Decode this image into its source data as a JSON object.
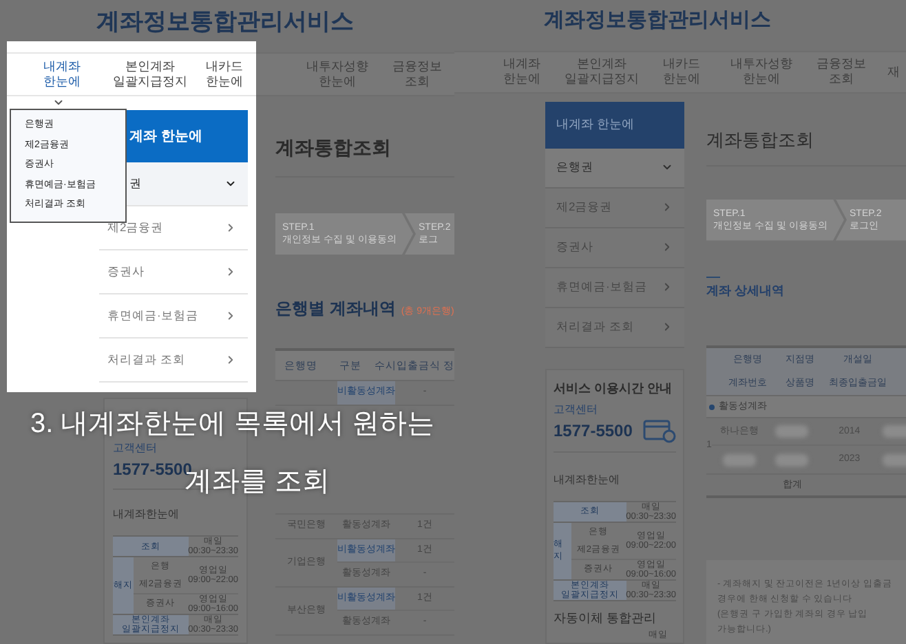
{
  "caption": {
    "lines": [
      "3. 내계좌한눈에 목록에서 원하는",
      "계좌를 조회"
    ]
  },
  "left_screen": {
    "site_title": "계좌정보통합관리서비스",
    "nav_tabs": [
      {
        "lines": [
          "내계좌",
          "한눈에"
        ],
        "selected": true
      },
      {
        "lines": [
          "본인계좌",
          "일괄지급정지"
        ],
        "selected": false
      },
      {
        "lines": [
          "내카드",
          "한눈에"
        ],
        "selected": false
      },
      {
        "lines": [
          "내투자성향",
          "한눈에"
        ],
        "selected": false
      },
      {
        "lines": [
          "금융정보",
          "조회"
        ],
        "selected": false
      }
    ],
    "dropdown": {
      "items": [
        "은행권",
        "제2금융권",
        "증권사",
        "휴면예금·보험금",
        "처리결과 조회"
      ]
    },
    "sidebar": {
      "header": "계좌 한눈에",
      "items": [
        {
          "label": "권",
          "expanded": true
        },
        {
          "label": "제2금융권",
          "expanded": false
        },
        {
          "label": "증권사",
          "expanded": false
        },
        {
          "label": "휴면예금·보험금",
          "expanded": false
        },
        {
          "label": "처리결과 조회",
          "expanded": false
        }
      ]
    },
    "page_title": "계좌통합조회",
    "steps": [
      {
        "label": "STEP.1",
        "text": "개인정보 수집 및 이용동의"
      },
      {
        "label": "STEP.2",
        "text": "로그"
      }
    ],
    "section_title": "은행별 계좌내역",
    "section_count": "(총 9개은행)",
    "table": {
      "columns": [
        "은행명",
        "구분",
        "수시입출금식 정"
      ],
      "groups": [
        {
          "rows": [
            {
              "kind": "inactive",
              "type": "비활동성계좌",
              "value": "-"
            }
          ]
        },
        {
          "bank": "국민은행",
          "rows": [
            {
              "kind": "active",
              "type": "활동성계좌",
              "value": "1건"
            }
          ]
        },
        {
          "bank": "기업은행",
          "rows": [
            {
              "kind": "inactive",
              "type": "비활동성계좌",
              "value": "1건"
            },
            {
              "kind": "active",
              "type": "활동성계좌",
              "value": "-"
            }
          ]
        },
        {
          "bank": "부산은행",
          "rows": [
            {
              "kind": "inactive",
              "type": "비활동성계좌",
              "value": "1건"
            },
            {
              "kind": "active",
              "type": "활동성계좌",
              "value": "-"
            }
          ]
        }
      ]
    },
    "service_box": {
      "phone_label": "고객센터",
      "phone": "1577-5500",
      "hours_title": "내계좌한눈에",
      "hours": [
        {
          "kind": "single",
          "label": [
            "조회"
          ],
          "day": "매일",
          "time": "00:30~23:30"
        },
        {
          "kind": "group",
          "label": "해지",
          "items": [
            {
              "labels": [
                "은행",
                "제2금융권"
              ],
              "day": "영업일",
              "time": "09:00~22:00"
            },
            {
              "labels": [
                "증권사"
              ],
              "day": "영업일",
              "time": "09:00~16:00"
            }
          ]
        },
        {
          "kind": "single",
          "label": [
            "본인계좌",
            "일괄지급정지"
          ],
          "day": "매일",
          "time": "00:30~23:30"
        }
      ]
    }
  },
  "right_screen": {
    "site_title": "계좌정보통합관리서비스",
    "nav_tabs": [
      {
        "lines": [
          "내계좌",
          "한눈에"
        ],
        "selected": false
      },
      {
        "lines": [
          "본인계좌",
          "일괄지급정지"
        ],
        "selected": false
      },
      {
        "lines": [
          "내카드",
          "한눈에"
        ],
        "selected": false
      },
      {
        "lines": [
          "내투자성향",
          "한눈에"
        ],
        "selected": false
      },
      {
        "lines": [
          "금융정보",
          "조회"
        ],
        "selected": false
      },
      {
        "lines": [
          "재"
        ],
        "selected": false
      }
    ],
    "sidebar": {
      "header": "내계좌 한눈에",
      "items": [
        {
          "label": "은행권",
          "expanded": true
        },
        {
          "label": "제2금융권",
          "expanded": false
        },
        {
          "label": "증권사",
          "expanded": false
        },
        {
          "label": "휴면예금·보험금",
          "expanded": false
        },
        {
          "label": "처리결과 조회",
          "expanded": false
        }
      ]
    },
    "service_box": {
      "title": "서비스 이용시간 안내",
      "phone_label": "고객센터",
      "phone": "1577-5500",
      "hours_title": "내계좌한눈에",
      "hours": [
        {
          "kind": "single",
          "label": [
            "조회"
          ],
          "day": "매일",
          "time": "00:30~23:30"
        },
        {
          "kind": "group",
          "label": "해지",
          "items": [
            {
              "labels": [
                "은행",
                "제2금융권"
              ],
              "day": "영업일",
              "time": "09:00~22:00"
            },
            {
              "labels": [
                "증권사"
              ],
              "day": "영업일",
              "time": "09:00~16:00"
            }
          ]
        },
        {
          "kind": "single",
          "label": [
            "본인계좌",
            "일괄지급정지"
          ],
          "day": "매일",
          "time": "00:30~23:30"
        }
      ],
      "auto_title": "자동이체 통합관리",
      "auto_day": "매일"
    },
    "page_title": "계좌통합조회",
    "steps": [
      {
        "label": "STEP.1",
        "text": "개인정보 수집 및 이용동의"
      },
      {
        "label": "STEP.2",
        "text": "로그인"
      }
    ],
    "section_title": "계좌 상세내역",
    "detail_table": {
      "header_rows": [
        [
          "은행명",
          "지점명",
          "개설일"
        ],
        [
          "계좌번호",
          "상품명",
          "최종입출금일"
        ]
      ],
      "section": "활동성계좌",
      "rows": [
        {
          "no": "1",
          "lines": [
            [
              {
                "kind": "text",
                "text": "하나은행"
              },
              {
                "kind": "redacted"
              },
              {
                "kind": "text",
                "text": "2014"
              },
              {
                "kind": "redacted"
              }
            ],
            [
              {
                "kind": "redacted"
              },
              {
                "kind": "redacted"
              },
              {
                "kind": "text",
                "text": "2023"
              },
              {
                "kind": "redacted"
              }
            ]
          ]
        }
      ],
      "total": "합계"
    },
    "notes": [
      "- 계좌해지 및 잔고이전은 1년이상 입출금",
      "경우에 한해 신청할 수 있습니다",
      "(은행권 구 가입한 계좌의 경우 납입",
      "가능합니다.)"
    ]
  }
}
